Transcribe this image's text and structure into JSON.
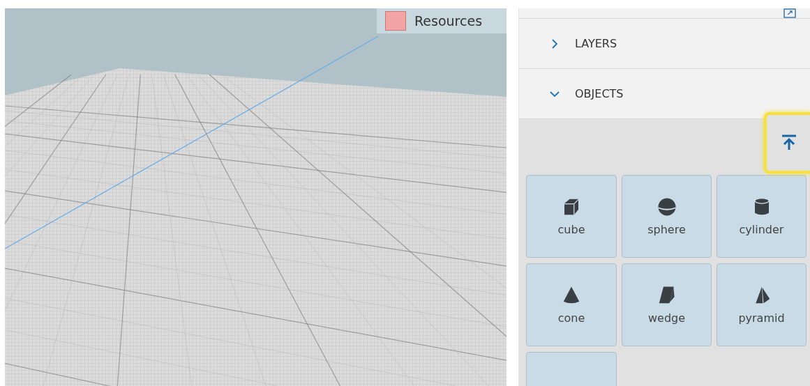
{
  "viewport": {
    "legend": [
      {
        "label": "Resources",
        "color": "#f2a3a3"
      }
    ]
  },
  "sidebar": {
    "sections": [
      {
        "label": "LAYERS",
        "expanded": false
      },
      {
        "label": "OBJECTS",
        "expanded": true
      }
    ],
    "scroll_top_button": {
      "highlighted": true
    },
    "objects": [
      {
        "kind": "cube",
        "label": "cube"
      },
      {
        "kind": "sphere",
        "label": "sphere"
      },
      {
        "kind": "cylinder",
        "label": "cylinder"
      },
      {
        "kind": "cone",
        "label": "cone"
      },
      {
        "kind": "wedge",
        "label": "wedge"
      },
      {
        "kind": "pyramid",
        "label": "pyramid"
      },
      {
        "kind": "partial"
      }
    ]
  }
}
